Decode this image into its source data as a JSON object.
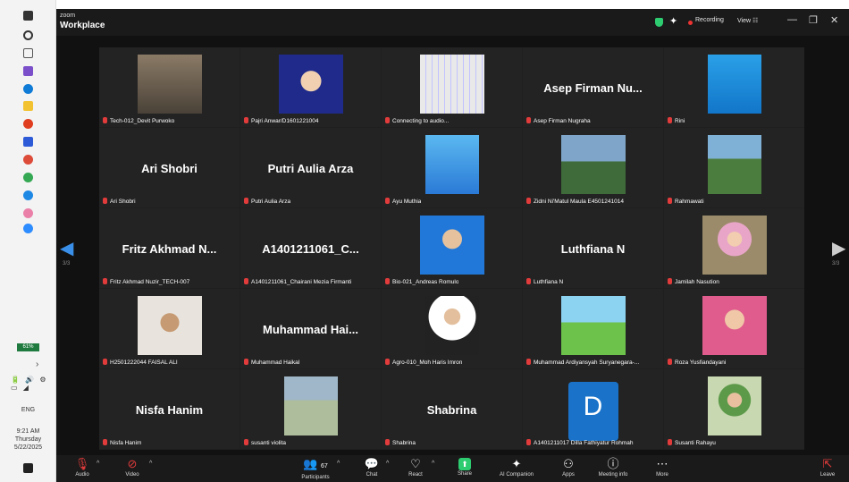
{
  "taskbar": {
    "icons": [
      "windows-start-icon",
      "search-icon",
      "task-view-icon",
      "outlook-icon",
      "edge-icon",
      "file-explorer-icon",
      "office-icon",
      "teams-icon",
      "chrome-icon",
      "chrome-profile-icon",
      "app-icon",
      "photos-icon",
      "zoom-icon"
    ],
    "battery": "61%",
    "language": "ENG",
    "time": "9:21 AM",
    "day": "Thursday",
    "date": "5/22/2025"
  },
  "titlebar": {
    "brand_small": "zoom",
    "brand": "Workplace",
    "recording": "Recording",
    "view": "View ☷"
  },
  "pager": {
    "left": "3/3",
    "right": "3/3"
  },
  "tiles": [
    {
      "id": "t1",
      "label": "Tech-012_Devit Purwoko",
      "big": "",
      "thumb": "photo-room"
    },
    {
      "id": "t2",
      "label": "Pajri Anwar/D1601221004",
      "big": "",
      "thumb": "photo-portrait-blue"
    },
    {
      "id": "t3",
      "label": "Connecting to audio...",
      "big": "",
      "thumb": "multiplication-table"
    },
    {
      "id": "t4",
      "label": "Asep Firman Nugraha",
      "big": "Asep Firman Nu...",
      "thumb": ""
    },
    {
      "id": "t5",
      "label": "Rini",
      "big": "",
      "thumb": "lab-illustration"
    },
    {
      "id": "t6",
      "label": "Ari Shobri",
      "big": "Ari Shobri",
      "thumb": ""
    },
    {
      "id": "t7",
      "label": "Putri Aulia Arza",
      "big": "Putri Aulia Arza",
      "thumb": ""
    },
    {
      "id": "t8",
      "label": "Ayu Muthia",
      "big": "",
      "thumb": "isometric-chart"
    },
    {
      "id": "t9",
      "label": "Zidni Ni'Matul Maula E4501241014",
      "big": "",
      "thumb": "campus-photo"
    },
    {
      "id": "t10",
      "label": "Rahmawati",
      "big": "",
      "thumb": "group-photo"
    },
    {
      "id": "t11",
      "label": "Fritz Akhmad Nuzir_TECH-007",
      "big": "Fritz Akhmad N...",
      "thumb": ""
    },
    {
      "id": "t12",
      "label": "A1401211061_Chairani Mezia Firmanti",
      "big": "A1401211061_C...",
      "thumb": ""
    },
    {
      "id": "t13",
      "label": "Bio-021_Andreas Romulo",
      "big": "",
      "thumb": "portrait-man-blue"
    },
    {
      "id": "t14",
      "label": "Luthfiana N",
      "big": "Luthfiana N",
      "thumb": ""
    },
    {
      "id": "t15",
      "label": "Jamilah Nasution",
      "big": "",
      "thumb": "hijab-portrait"
    },
    {
      "id": "t16",
      "label": "H2501222044 FAISAL ALI",
      "big": "",
      "thumb": "man-hat"
    },
    {
      "id": "t17",
      "label": "Muhammad Haikal",
      "big": "Muhammad  Hai...",
      "thumb": ""
    },
    {
      "id": "t18",
      "label": "Agro-010_Moh Haris Imron",
      "big": "",
      "thumb": "man-suit"
    },
    {
      "id": "t19",
      "label": "Muhammad Ardiyansyah Suryanegara-...",
      "big": "",
      "thumb": "farm-illustration"
    },
    {
      "id": "t20",
      "label": "Roza Yusfiandayani",
      "big": "",
      "thumb": "woman-pink"
    },
    {
      "id": "t21",
      "label": "Nisfa Hanim",
      "big": "Nisfa Hanim",
      "thumb": ""
    },
    {
      "id": "t22",
      "label": "susanti violita",
      "big": "",
      "thumb": "woman-outdoor"
    },
    {
      "id": "t23",
      "label": "Shabrina",
      "big": "Shabrina",
      "thumb": ""
    },
    {
      "id": "t24",
      "label": "A1401211017 Dilla Fathiyatur Rohmah",
      "big": "",
      "thumb": "avatar-D",
      "avatar_letter": "D"
    },
    {
      "id": "t25",
      "label": "Susanti Rahayu",
      "big": "",
      "thumb": "hijab-woman-2"
    }
  ],
  "controls": {
    "audio": "Audio",
    "video": "Video",
    "participants_count": "67",
    "participants": "Participants",
    "chat": "Chat",
    "react": "React",
    "share": "Share",
    "ai": "AI Companion",
    "apps": "Apps",
    "meeting_info": "Meeting info",
    "more": "More",
    "leave": "Leave"
  },
  "colors": {
    "mic_muted": "#e23b3b",
    "accent": "#3a8fe8",
    "share_green": "#2ecc71"
  }
}
